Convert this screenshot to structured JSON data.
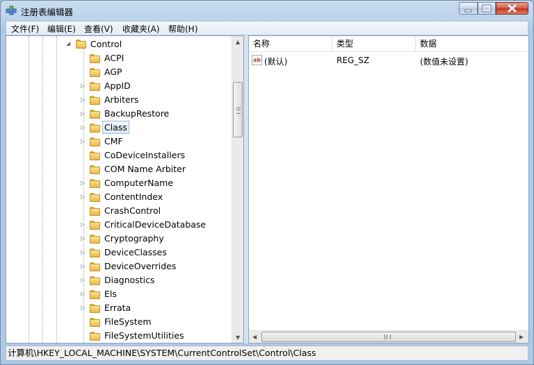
{
  "window": {
    "title": "注册表编辑器",
    "controls": {
      "minimize": "minimize",
      "maximize": "maximize",
      "close": "close"
    }
  },
  "menu": [
    {
      "label": "文件(F)"
    },
    {
      "label": "编辑(E)"
    },
    {
      "label": "查看(V)"
    },
    {
      "label": "收藏夹(A)"
    },
    {
      "label": "帮助(H)"
    }
  ],
  "tree": {
    "parent": {
      "label": "Control",
      "expanded": true
    },
    "items": [
      {
        "label": "ACPI",
        "has_children": false
      },
      {
        "label": "AGP",
        "has_children": false
      },
      {
        "label": "AppID",
        "has_children": true
      },
      {
        "label": "Arbiters",
        "has_children": true
      },
      {
        "label": "BackupRestore",
        "has_children": true
      },
      {
        "label": "Class",
        "has_children": true,
        "selected": true
      },
      {
        "label": "CMF",
        "has_children": true
      },
      {
        "label": "CoDeviceInstallers",
        "has_children": false
      },
      {
        "label": "COM Name Arbiter",
        "has_children": false
      },
      {
        "label": "ComputerName",
        "has_children": true
      },
      {
        "label": "ContentIndex",
        "has_children": true
      },
      {
        "label": "CrashControl",
        "has_children": false
      },
      {
        "label": "CriticalDeviceDatabase",
        "has_children": true
      },
      {
        "label": "Cryptography",
        "has_children": true
      },
      {
        "label": "DeviceClasses",
        "has_children": true
      },
      {
        "label": "DeviceOverrides",
        "has_children": true
      },
      {
        "label": "Diagnostics",
        "has_children": true
      },
      {
        "label": "Els",
        "has_children": true
      },
      {
        "label": "Errata",
        "has_children": true
      },
      {
        "label": "FileSystem",
        "has_children": false
      },
      {
        "label": "FileSystemUtilities",
        "has_children": false
      }
    ]
  },
  "values_list": {
    "columns": [
      "名称",
      "类型",
      "数据"
    ],
    "rows": [
      {
        "name": "(默认)",
        "type": "REG_SZ",
        "data": "(数值未设置)",
        "icon": "string-value-icon"
      }
    ]
  },
  "status_path": "计算机\\HKEY_LOCAL_MACHINE\\SYSTEM\\CurrentControlSet\\Control\\Class",
  "colors": {
    "accent": "#9cb8d9",
    "folder": "#eab74c",
    "close_button": "#c4361f"
  }
}
